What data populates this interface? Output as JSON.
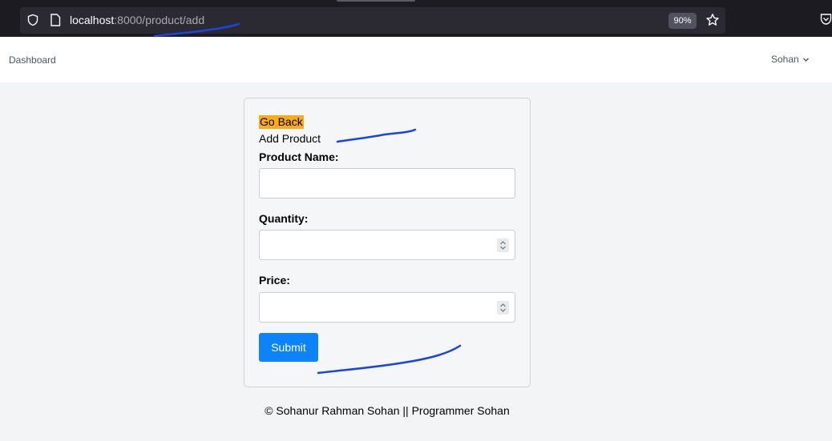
{
  "browser": {
    "url_host": "localhost",
    "url_rest": ":8000/product/add",
    "zoom": "90%"
  },
  "header": {
    "nav_dashboard": "Dashboard",
    "user_name": "Sohan"
  },
  "form": {
    "go_back": "Go Back",
    "title": "Add Product",
    "fields": [
      {
        "label": "Product Name:",
        "type": "text",
        "value": ""
      },
      {
        "label": "Quantity:",
        "type": "number",
        "value": ""
      },
      {
        "label": "Price:",
        "type": "number",
        "value": ""
      }
    ],
    "submit_label": "Submit"
  },
  "footer": {
    "text": "© Sohanur Rahman Sohan || Programmer Sohan"
  },
  "colors": {
    "accent_button": "#0d83f9",
    "go_back_highlight": "#fbab17",
    "annotation_ink": "#1a45e0"
  },
  "icons": [
    "shield-icon",
    "page-icon",
    "star-icon",
    "pocket-icon",
    "chevron-down-icon",
    "spinner-icon"
  ]
}
